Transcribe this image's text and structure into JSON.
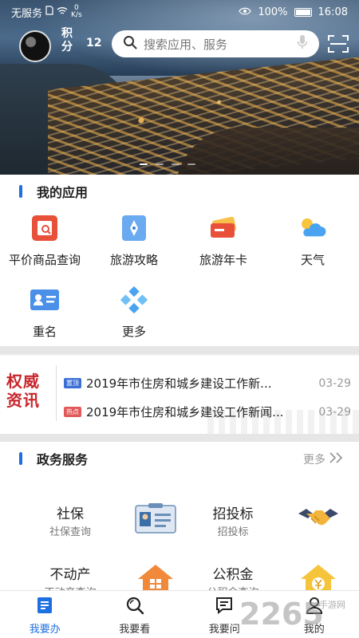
{
  "status_bar": {
    "carrier": "无服务",
    "net_speed_value": "0",
    "net_speed_unit": "K/s",
    "battery": "100%",
    "time": "16:08"
  },
  "header": {
    "points_label": "积分",
    "points_value": "12",
    "search_placeholder": "搜索应用、服务",
    "carousel": {
      "count": 4,
      "active_index": 0
    }
  },
  "my_apps": {
    "title": "我的应用",
    "items": [
      {
        "label": "平价商品查询",
        "icon": "price-query-icon"
      },
      {
        "label": "旅游攻略",
        "icon": "travel-guide-icon"
      },
      {
        "label": "旅游年卡",
        "icon": "travel-card-icon"
      },
      {
        "label": "天气",
        "icon": "weather-icon"
      },
      {
        "label": "重名",
        "icon": "name-check-icon"
      },
      {
        "label": "更多",
        "icon": "more-apps-icon"
      }
    ]
  },
  "news": {
    "logo_line1": "权威",
    "logo_line2": "资讯",
    "items": [
      {
        "tag": "置顶",
        "tag_color": "#3b6fd6",
        "text": "2019年市住房和城乡建设工作新...",
        "date": "03-29"
      },
      {
        "tag": "热点",
        "tag_color": "#e05a5a",
        "text": "2019年市住房和城乡建设工作新闻...",
        "date": "03-29"
      }
    ]
  },
  "gov_services": {
    "title": "政务服务",
    "more_label": "更多",
    "items": [
      {
        "title": "社保",
        "subtitle": "社保查询",
        "icon": "id-card-icon"
      },
      {
        "title": "招投标",
        "subtitle": "招投标",
        "icon": "handshake-icon"
      },
      {
        "title": "不动产",
        "subtitle": "不动产查询",
        "icon": "house-icon"
      },
      {
        "title": "公积金",
        "subtitle": "公积金查询",
        "icon": "fund-house-icon"
      }
    ]
  },
  "bottom_nav": {
    "items": [
      {
        "label": "我要办",
        "icon": "doc-icon",
        "active": true
      },
      {
        "label": "我要看",
        "icon": "search-icon",
        "active": false
      },
      {
        "label": "我要问",
        "icon": "chat-icon",
        "active": false
      },
      {
        "label": "我的",
        "icon": "user-icon",
        "active": false
      }
    ]
  },
  "watermark": {
    "text": "2265",
    "sub": "手游网"
  },
  "colors": {
    "accent": "#1e6fe0",
    "news_red": "#c8262d"
  }
}
